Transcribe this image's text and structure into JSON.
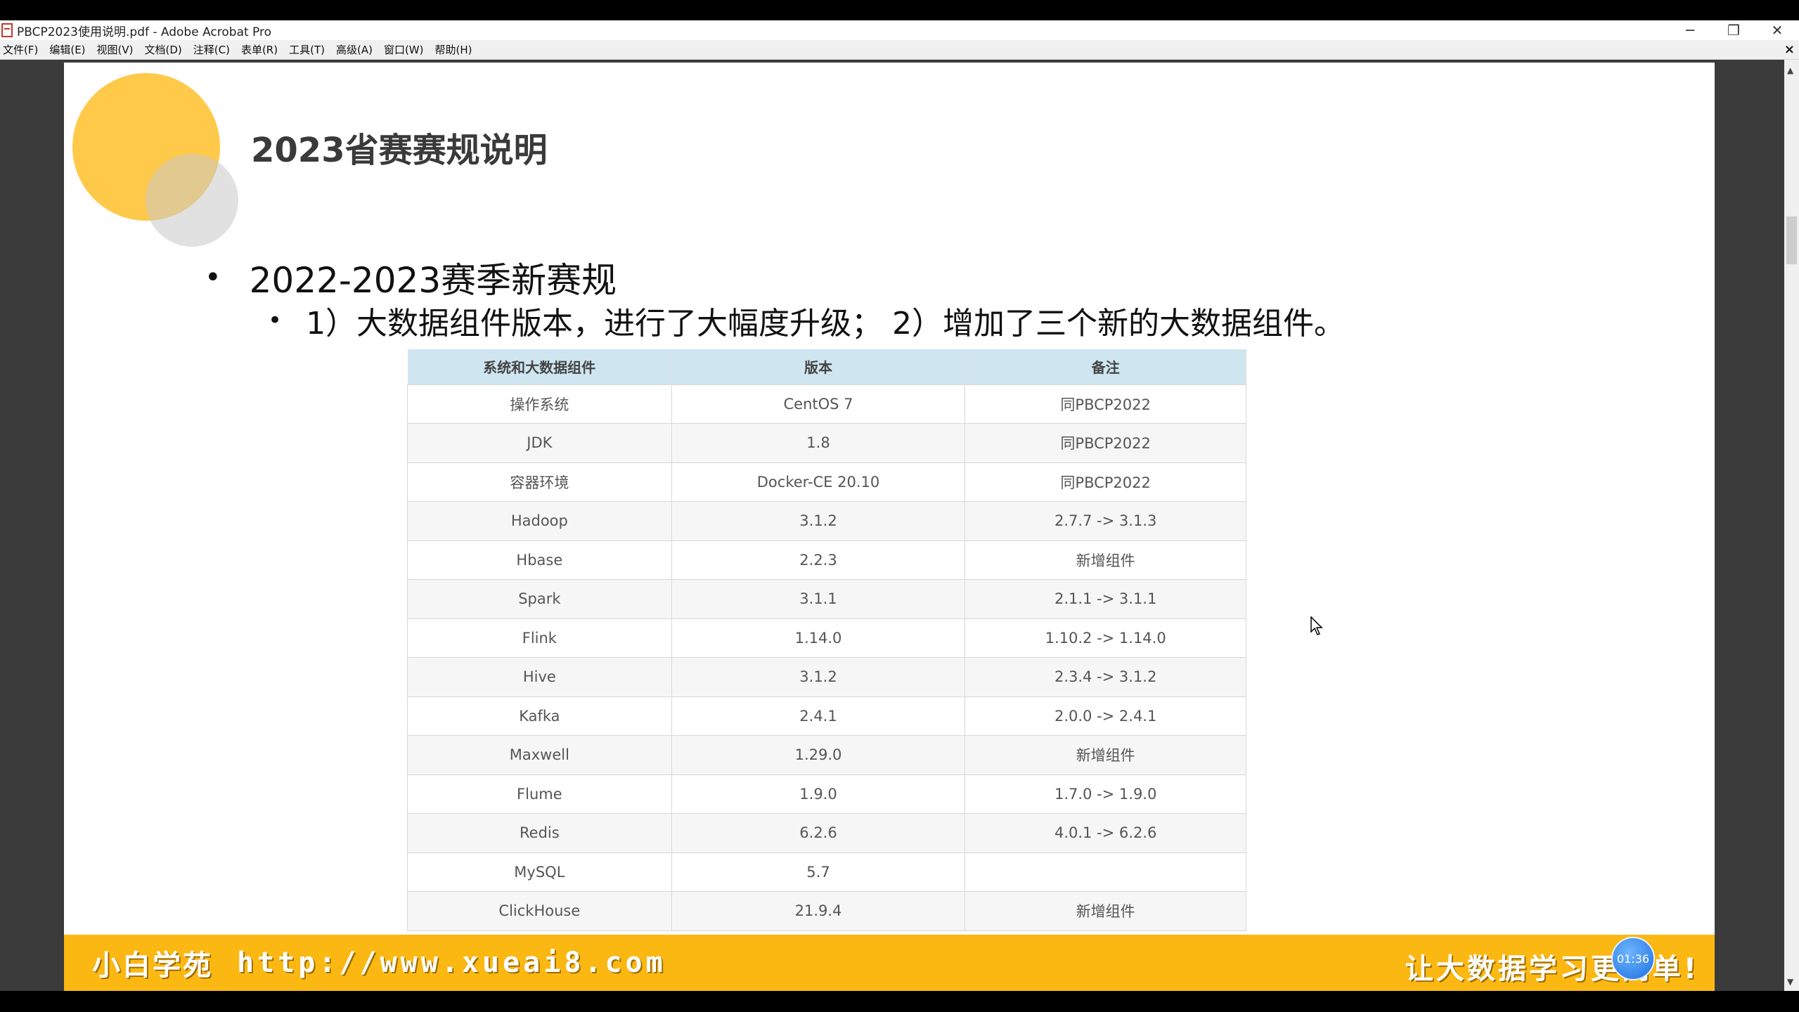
{
  "window": {
    "title": "PBCP2023使用说明.pdf - Adobe Acrobat Pro",
    "minimize_glyph": "─",
    "restore_glyph": "❐",
    "close_glyph": "✕"
  },
  "menu": {
    "items": [
      "文件(F)",
      "编辑(E)",
      "视图(V)",
      "文档(D)",
      "注释(C)",
      "表单(R)",
      "工具(T)",
      "高级(A)",
      "窗口(W)",
      "帮助(H)"
    ],
    "close_glyph": "×"
  },
  "slide": {
    "title": "2023省赛赛规说明",
    "bullet1": "2022-2023赛季新赛规",
    "bullet2": "1）大数据组件版本，进行了大幅度升级； 2）增加了三个新的大数据组件。",
    "bullet_glyph": "•",
    "table": {
      "headers": [
        "系统和大数据组件",
        "版本",
        "备注"
      ],
      "rows": [
        [
          "操作系统",
          "CentOS 7",
          "同PBCP2022"
        ],
        [
          "JDK",
          "1.8",
          "同PBCP2022"
        ],
        [
          "容器环境",
          "Docker-CE 20.10",
          "同PBCP2022"
        ],
        [
          "Hadoop",
          "3.1.2",
          "2.7.7 -> 3.1.3"
        ],
        [
          "Hbase",
          "2.2.3",
          "新增组件"
        ],
        [
          "Spark",
          "3.1.1",
          "2.1.1 -> 3.1.1"
        ],
        [
          "Flink",
          "1.14.0",
          "1.10.2 -> 1.14.0"
        ],
        [
          "Hive",
          "3.1.2",
          "2.3.4 -> 3.1.2"
        ],
        [
          "Kafka",
          "2.4.1",
          "2.0.0 -> 2.4.1"
        ],
        [
          "Maxwell",
          "1.29.0",
          "新增组件"
        ],
        [
          "Flume",
          "1.9.0",
          "1.7.0 -> 1.9.0"
        ],
        [
          "Redis",
          "6.2.6",
          "4.0.1 -> 6.2.6"
        ],
        [
          "MySQL",
          "5.7",
          ""
        ],
        [
          "ClickHouse",
          "21.9.4",
          "新增组件"
        ]
      ]
    }
  },
  "banner": {
    "brand": "小白学苑",
    "url": "http://www.xueai8.com",
    "slogan": "让大数据学习更简单!",
    "timer": "01:36"
  },
  "scrollbar": {
    "up_glyph": "▲",
    "down_glyph": "▼"
  }
}
